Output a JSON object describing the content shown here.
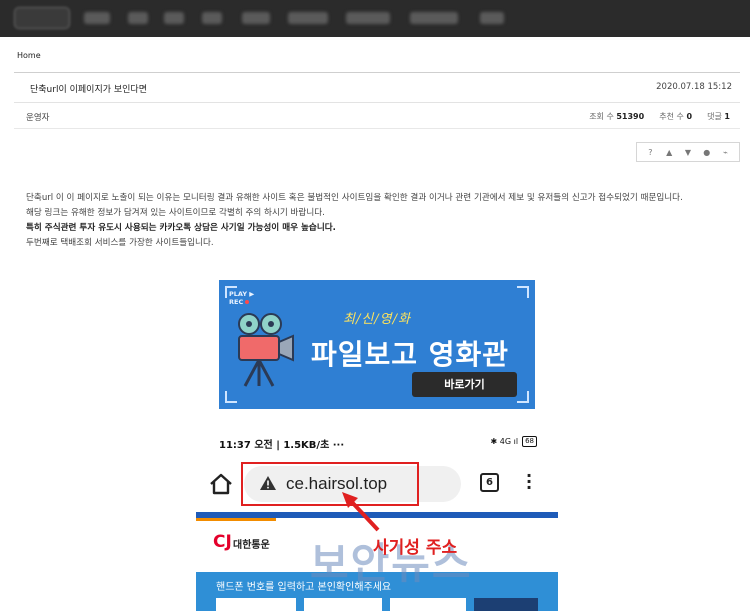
{
  "nav": {
    "logo_text": "",
    "items": [
      "",
      "",
      "",
      "",
      "",
      "",
      "",
      ""
    ]
  },
  "breadcrumb": "Home",
  "post": {
    "title": "단축url이 이페이지가 보인다면",
    "date": "2020.07.18 15:12",
    "author": "운영자",
    "views_label": "조회 수",
    "views": "51390",
    "likes_label": "추천 수",
    "likes": "0",
    "comments_label": "댓글",
    "comments": "1"
  },
  "toolbox": {
    "icons": [
      "question-icon",
      "arrow-up-icon",
      "arrow-down-icon",
      "comment-icon",
      "clip-icon"
    ],
    "glyphs": [
      "?",
      "▲",
      "▼",
      "●",
      "⌁"
    ]
  },
  "body": {
    "line1": "단축url 이 이 페이지로 노출이 되는 이유는 모니터링 결과 유해한 사이트 혹은 불법적인 사이트임을 확인한 결과 이거나 관련 기관에서 제보 및 유저들의 신고가 접수되었기 때문입니다.",
    "line2": "해당 링크는 유해한 정보가 담겨져 있는 사이트이므로 각별히 주의 하시기 바랍니다.",
    "line3": "특히 주식관련 투자 유도시 사용되는 카카오톡 상담은 사기일 가능성이 매우 높습니다.",
    "line4": "두번째로 택배조회 서비스를 가장한 사이트들입니다."
  },
  "banner": {
    "play": "PLAY ▶",
    "rec": "REC",
    "cursive": "최/신/영/화",
    "title": "파일보고 영화관",
    "button": "바로가기",
    "colors": {
      "background": "#2f7fd3",
      "accent": "#ffe45c"
    }
  },
  "phone": {
    "status_left": "11:37 오전 | 1.5KB/초 ···",
    "status_icons": "✱ 4G ıl",
    "battery": "68",
    "url": "ce.hairsol.top",
    "tab_count": "6",
    "page_logo": "CJ",
    "page_logo_sub": "대한통운",
    "page_prompt": "핸드폰 번호를 입력하고 본인확인해주세요"
  },
  "annotation": {
    "scam_label": "사기성 주소",
    "watermark": "보안뉴스",
    "color": "#e02020"
  }
}
